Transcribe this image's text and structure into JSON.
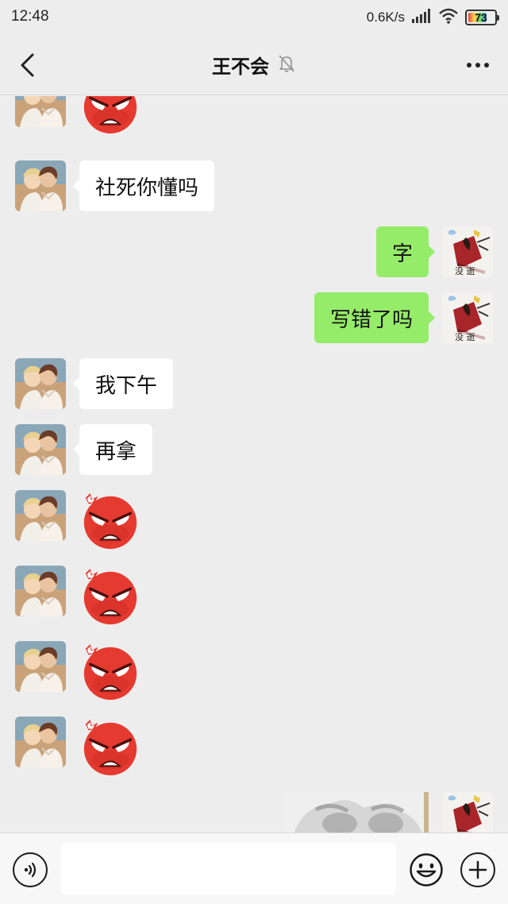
{
  "status_bar": {
    "time": "12:48",
    "net_speed": "0.6K/s",
    "battery": "73",
    "battery_level_percent": 73
  },
  "header": {
    "title": "王不会",
    "mute_icon": "bell-off-icon",
    "back_icon": "chevron-left-icon",
    "more_icon": "more-dots-icon"
  },
  "messages": [
    {
      "side": "left",
      "type": "sticker",
      "sticker": "angry-face"
    },
    {
      "side": "left",
      "type": "text",
      "text": "社死你懂吗"
    },
    {
      "side": "right",
      "type": "text",
      "text": "字"
    },
    {
      "side": "right",
      "type": "text",
      "text": "写错了吗"
    },
    {
      "side": "left",
      "type": "text",
      "text": "我下午"
    },
    {
      "side": "left",
      "type": "text",
      "text": "再拿"
    },
    {
      "side": "left",
      "type": "sticker",
      "sticker": "angry-face"
    },
    {
      "side": "left",
      "type": "sticker",
      "sticker": "angry-face"
    },
    {
      "side": "left",
      "type": "sticker",
      "sticker": "angry-face"
    },
    {
      "side": "left",
      "type": "sticker",
      "sticker": "angry-face"
    },
    {
      "side": "right",
      "type": "image",
      "image": "blurry-photo"
    }
  ],
  "input_bar": {
    "placeholder": "",
    "voice_icon": "voice-icon",
    "emoji_icon": "emoji-icon",
    "plus_icon": "plus-icon"
  },
  "colors": {
    "background": "#ededed",
    "bubble_left": "#ffffff",
    "bubble_right": "#95ec69",
    "input_bar": "#f7f7f7"
  }
}
